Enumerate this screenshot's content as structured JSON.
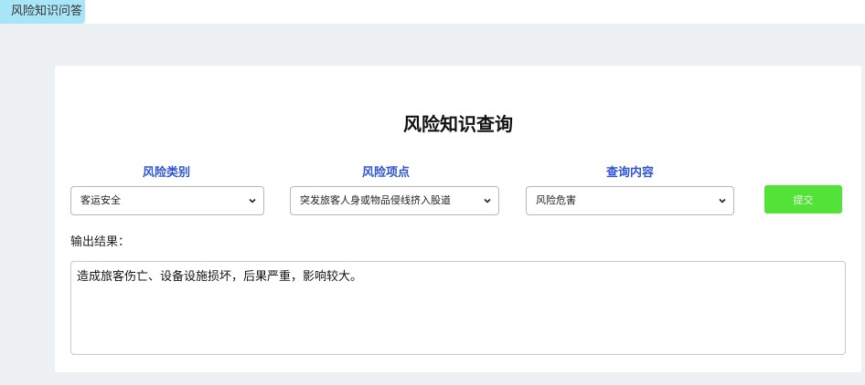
{
  "tab": {
    "label": "风险知识问答"
  },
  "page": {
    "title": "风险知识查询"
  },
  "fields": {
    "category": {
      "label": "风险类别",
      "value": "客运安全"
    },
    "item": {
      "label": "风险项点",
      "value": "突发旅客人身或物品侵线挤入股道"
    },
    "query": {
      "label": "查询内容",
      "value": "风险危害"
    }
  },
  "submit": {
    "label": "提交"
  },
  "output": {
    "label": "输出结果：",
    "text": "造成旅客伤亡、设备设施损坏，后果严重，影响较大。"
  },
  "colors": {
    "tab": "#a8e6f7",
    "label_accent": "#2f55d4",
    "submit": "#52e238",
    "background": "#eef1f3"
  },
  "icons": {
    "select_arrow": "chevron-down-icon"
  }
}
